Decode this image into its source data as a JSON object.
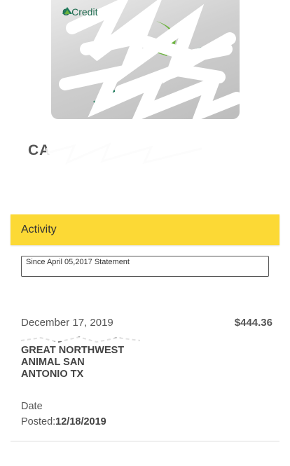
{
  "card": {
    "brand_prefix": "C",
    "brand": "Credit",
    "name_visible": "CA"
  },
  "activity": {
    "title": "Activity"
  },
  "statement_select": {
    "selected": "Since April 05,2017 Statement"
  },
  "transaction": {
    "date": "December 17, 2019",
    "amount": "$444.36",
    "description": "GREAT NORTHWEST ANIMAL SAN ANTONIO TX",
    "date_label": "Date",
    "posted_label": "Posted:",
    "posted_date": "12/18/2019"
  }
}
